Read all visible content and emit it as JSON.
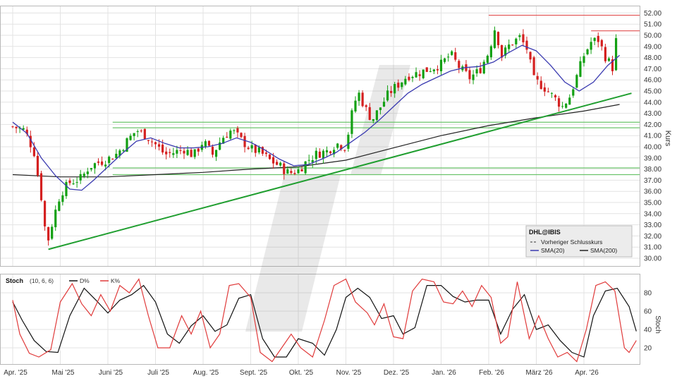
{
  "chart_data": [
    {
      "type": "candlestick",
      "ylabel": "Kurs",
      "ylim": [
        29,
        53
      ],
      "ytick_labels": [
        "30.00",
        "31.00",
        "32.00",
        "33.00",
        "34.00",
        "35.00",
        "36.00",
        "37.00",
        "38.00",
        "39.00",
        "40.00",
        "41.00",
        "42.00",
        "43.00",
        "44.00",
        "45.00",
        "46.00",
        "47.00",
        "48.00",
        "49.00",
        "50.00",
        "51.00",
        "52.00"
      ],
      "months": [
        "Apr. '25",
        "Mai '25",
        "Juni '25",
        "Juli '25",
        "Aug. '25",
        "Sept. '25",
        "Okt. '25",
        "Nov. '25",
        "Dez. '25",
        "Jan. '26",
        "Feb. '26",
        "März '26",
        "Apr. '26"
      ],
      "grid": true,
      "legend": {
        "position": "bottom-right",
        "title": "DHL@IBIS",
        "prev_close_label": "Vorheriger Schlusskurs",
        "sma20_label": "SMA(20)",
        "sma200_label": "SMA(200)"
      },
      "colors": {
        "up": "#13a013",
        "down": "#d42020",
        "sma20": "#3a3ab0",
        "sma200": "#222222",
        "trendline": "#1f9e2f",
        "support": "#6cc46c",
        "resistance": "#e05050"
      },
      "horizontal_levels": [
        42.2,
        41.7,
        38.1,
        37.5
      ],
      "resistance_levels": [
        51.8,
        50.4
      ],
      "trendline": {
        "from": {
          "month_index": 0.75,
          "value": 30.8
        },
        "to": {
          "month_index": 13.0,
          "value": 44.8
        }
      },
      "price_path": [
        [
          0.0,
          41.8
        ],
        [
          0.25,
          41.5
        ],
        [
          0.45,
          39.5
        ],
        [
          0.6,
          35.5
        ],
        [
          0.72,
          31.2
        ],
        [
          0.85,
          33.5
        ],
        [
          1.0,
          35.8
        ],
        [
          1.2,
          36.8
        ],
        [
          1.45,
          37.2
        ],
        [
          1.6,
          38.2
        ],
        [
          1.8,
          38.6
        ],
        [
          2.0,
          38.9
        ],
        [
          2.2,
          39.4
        ],
        [
          2.4,
          40.5
        ],
        [
          2.6,
          41.5
        ],
        [
          2.8,
          41.0
        ],
        [
          3.0,
          40.2
        ],
        [
          3.2,
          39.3
        ],
        [
          3.4,
          39.5
        ],
        [
          3.6,
          39.8
        ],
        [
          3.8,
          39.2
        ],
        [
          4.0,
          40.5
        ],
        [
          4.2,
          39.3
        ],
        [
          4.4,
          40.8
        ],
        [
          4.6,
          41.5
        ],
        [
          4.8,
          40.6
        ],
        [
          5.0,
          39.8
        ],
        [
          5.2,
          39.5
        ],
        [
          5.4,
          38.8
        ],
        [
          5.6,
          38.3
        ],
        [
          5.8,
          37.6
        ],
        [
          6.0,
          37.9
        ],
        [
          6.2,
          38.8
        ],
        [
          6.4,
          39.4
        ],
        [
          6.6,
          39.6
        ],
        [
          6.8,
          40.3
        ],
        [
          7.0,
          40.0
        ],
        [
          7.1,
          42.5
        ],
        [
          7.25,
          45.0
        ],
        [
          7.4,
          43.5
        ],
        [
          7.55,
          42.4
        ],
        [
          7.7,
          43.4
        ],
        [
          7.9,
          44.8
        ],
        [
          8.1,
          45.6
        ],
        [
          8.3,
          46.4
        ],
        [
          8.5,
          46.6
        ],
        [
          8.7,
          46.9
        ],
        [
          9.0,
          47.4
        ],
        [
          9.2,
          48.3
        ],
        [
          9.4,
          47.0
        ],
        [
          9.6,
          46.2
        ],
        [
          9.8,
          46.8
        ],
        [
          10.0,
          48.5
        ],
        [
          10.15,
          51.0
        ],
        [
          10.25,
          48.0
        ],
        [
          10.45,
          49.2
        ],
        [
          10.65,
          49.8
        ],
        [
          10.8,
          48.8
        ],
        [
          10.95,
          46.0
        ],
        [
          11.15,
          45.4
        ],
        [
          11.35,
          44.5
        ],
        [
          11.55,
          43.6
        ],
        [
          11.7,
          44.5
        ],
        [
          11.85,
          46.3
        ],
        [
          12.0,
          48.2
        ],
        [
          12.15,
          49.4
        ],
        [
          12.3,
          49.6
        ],
        [
          12.45,
          48.1
        ],
        [
          12.6,
          47.1
        ],
        [
          12.7,
          50.3
        ]
      ],
      "sma20_path": [
        [
          0.0,
          42.2
        ],
        [
          0.3,
          41.2
        ],
        [
          0.6,
          39.0
        ],
        [
          0.9,
          37.4
        ],
        [
          1.2,
          36.2
        ],
        [
          1.45,
          36.1
        ],
        [
          1.7,
          37.0
        ],
        [
          2.0,
          38.2
        ],
        [
          2.3,
          39.4
        ],
        [
          2.6,
          40.5
        ],
        [
          2.9,
          40.8
        ],
        [
          3.2,
          40.3
        ],
        [
          3.5,
          39.9
        ],
        [
          3.8,
          39.9
        ],
        [
          4.1,
          40.0
        ],
        [
          4.4,
          40.3
        ],
        [
          4.7,
          40.8
        ],
        [
          5.0,
          40.4
        ],
        [
          5.3,
          39.7
        ],
        [
          5.6,
          38.9
        ],
        [
          5.9,
          38.3
        ],
        [
          6.2,
          38.4
        ],
        [
          6.5,
          38.9
        ],
        [
          6.8,
          39.5
        ],
        [
          7.1,
          40.4
        ],
        [
          7.4,
          41.3
        ],
        [
          7.7,
          42.4
        ],
        [
          8.0,
          43.6
        ],
        [
          8.3,
          44.8
        ],
        [
          8.6,
          45.6
        ],
        [
          8.9,
          46.2
        ],
        [
          9.2,
          46.8
        ],
        [
          9.5,
          47.1
        ],
        [
          9.8,
          47.2
        ],
        [
          10.1,
          47.6
        ],
        [
          10.4,
          48.4
        ],
        [
          10.7,
          49.1
        ],
        [
          11.0,
          48.6
        ],
        [
          11.3,
          47.3
        ],
        [
          11.6,
          45.8
        ],
        [
          11.9,
          45.0
        ],
        [
          12.2,
          45.8
        ],
        [
          12.5,
          47.3
        ],
        [
          12.75,
          48.2
        ]
      ],
      "sma200_path": [
        [
          0.0,
          37.5
        ],
        [
          1.0,
          37.3
        ],
        [
          2.0,
          37.3
        ],
        [
          3.0,
          37.5
        ],
        [
          4.0,
          37.7
        ],
        [
          5.0,
          38.0
        ],
        [
          6.0,
          38.2
        ],
        [
          7.0,
          38.8
        ],
        [
          8.0,
          39.9
        ],
        [
          9.0,
          41.0
        ],
        [
          10.0,
          41.9
        ],
        [
          11.0,
          42.6
        ],
        [
          12.0,
          43.2
        ],
        [
          12.75,
          43.8
        ]
      ]
    },
    {
      "type": "line",
      "title": "Stoch",
      "params": "(10, 6, 6)",
      "ylabel": "Stoch",
      "ylim": [
        0,
        100
      ],
      "ytick_labels": [
        "20",
        "40",
        "60",
        "80"
      ],
      "legend": {
        "position": "top-left"
      },
      "series": [
        {
          "name": "D%",
          "color": "#111111",
          "points": [
            [
              0.0,
              70
            ],
            [
              0.2,
              50
            ],
            [
              0.45,
              28
            ],
            [
              0.7,
              16
            ],
            [
              0.95,
              15
            ],
            [
              1.2,
              55
            ],
            [
              1.5,
              85
            ],
            [
              1.75,
              72
            ],
            [
              2.0,
              58
            ],
            [
              2.25,
              72
            ],
            [
              2.5,
              78
            ],
            [
              2.75,
              88
            ],
            [
              3.0,
              70
            ],
            [
              3.25,
              35
            ],
            [
              3.5,
              25
            ],
            [
              3.75,
              44
            ],
            [
              4.0,
              55
            ],
            [
              4.25,
              38
            ],
            [
              4.5,
              45
            ],
            [
              4.75,
              74
            ],
            [
              5.0,
              78
            ],
            [
              5.25,
              30
            ],
            [
              5.5,
              10
            ],
            [
              5.75,
              10
            ],
            [
              6.0,
              30
            ],
            [
              6.3,
              25
            ],
            [
              6.55,
              12
            ],
            [
              6.8,
              40
            ],
            [
              7.0,
              75
            ],
            [
              7.25,
              85
            ],
            [
              7.5,
              75
            ],
            [
              7.75,
              52
            ],
            [
              8.0,
              55
            ],
            [
              8.2,
              35
            ],
            [
              8.45,
              42
            ],
            [
              8.7,
              88
            ],
            [
              9.0,
              88
            ],
            [
              9.25,
              76
            ],
            [
              9.5,
              70
            ],
            [
              9.75,
              72
            ],
            [
              10.0,
              72
            ],
            [
              10.25,
              35
            ],
            [
              10.5,
              62
            ],
            [
              10.75,
              78
            ],
            [
              11.0,
              40
            ],
            [
              11.25,
              45
            ],
            [
              11.5,
              28
            ],
            [
              11.75,
              15
            ],
            [
              12.0,
              10
            ],
            [
              12.2,
              55
            ],
            [
              12.45,
              82
            ],
            [
              12.7,
              85
            ],
            [
              12.95,
              65
            ],
            [
              13.1,
              38
            ]
          ]
        },
        {
          "name": "K%",
          "color": "#e03a3a",
          "points": [
            [
              0.0,
              72
            ],
            [
              0.15,
              35
            ],
            [
              0.35,
              14
            ],
            [
              0.55,
              10
            ],
            [
              0.8,
              18
            ],
            [
              1.0,
              70
            ],
            [
              1.25,
              90
            ],
            [
              1.45,
              68
            ],
            [
              1.65,
              55
            ],
            [
              1.85,
              78
            ],
            [
              2.05,
              60
            ],
            [
              2.25,
              88
            ],
            [
              2.45,
              80
            ],
            [
              2.65,
              95
            ],
            [
              2.85,
              55
            ],
            [
              3.05,
              20
            ],
            [
              3.3,
              20
            ],
            [
              3.55,
              55
            ],
            [
              3.75,
              35
            ],
            [
              3.95,
              60
            ],
            [
              4.15,
              20
            ],
            [
              4.35,
              35
            ],
            [
              4.55,
              88
            ],
            [
              4.75,
              90
            ],
            [
              5.0,
              75
            ],
            [
              5.2,
              15
            ],
            [
              5.45,
              5
            ],
            [
              5.65,
              20
            ],
            [
              5.85,
              35
            ],
            [
              6.05,
              20
            ],
            [
              6.3,
              10
            ],
            [
              6.55,
              50
            ],
            [
              6.75,
              88
            ],
            [
              7.0,
              95
            ],
            [
              7.2,
              70
            ],
            [
              7.45,
              58
            ],
            [
              7.6,
              45
            ],
            [
              7.8,
              68
            ],
            [
              8.0,
              32
            ],
            [
              8.2,
              30
            ],
            [
              8.4,
              82
            ],
            [
              8.6,
              95
            ],
            [
              8.85,
              92
            ],
            [
              9.05,
              70
            ],
            [
              9.25,
              68
            ],
            [
              9.45,
              82
            ],
            [
              9.65,
              65
            ],
            [
              9.85,
              88
            ],
            [
              10.05,
              75
            ],
            [
              10.25,
              25
            ],
            [
              10.4,
              32
            ],
            [
              10.6,
              92
            ],
            [
              10.85,
              30
            ],
            [
              11.05,
              55
            ],
            [
              11.25,
              30
            ],
            [
              11.45,
              10
            ],
            [
              11.65,
              15
            ],
            [
              11.85,
              5
            ],
            [
              12.05,
              40
            ],
            [
              12.25,
              88
            ],
            [
              12.45,
              92
            ],
            [
              12.65,
              82
            ],
            [
              12.85,
              20
            ],
            [
              12.95,
              15
            ],
            [
              13.1,
              28
            ]
          ]
        }
      ]
    }
  ]
}
